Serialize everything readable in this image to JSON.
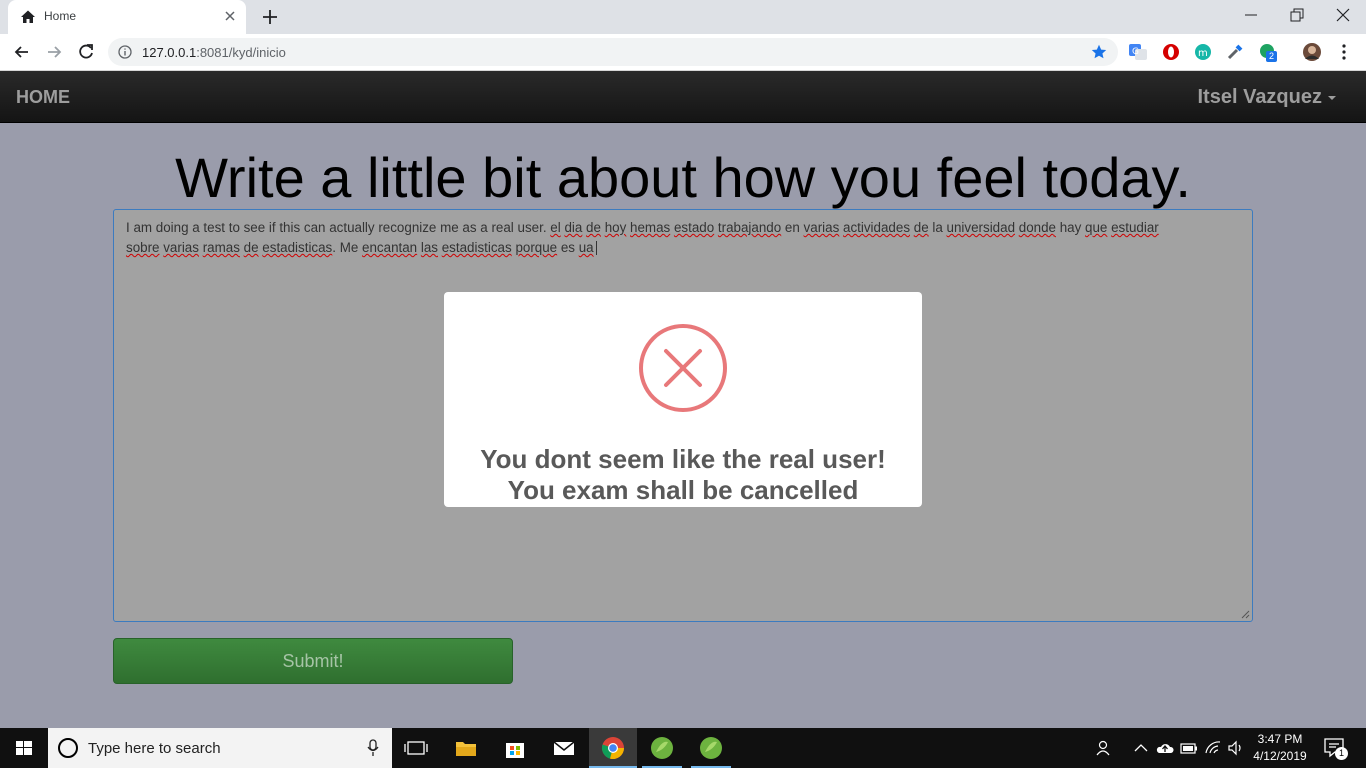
{
  "browser": {
    "tab_title": "Home",
    "url_host": "127.0.0.1",
    "url_path": ":8081/kyd/inicio",
    "icons": [
      "home-icon",
      "close-icon",
      "plus-icon",
      "back-icon",
      "forward-icon",
      "reload-icon",
      "info-icon",
      "star-icon",
      "translate-icon",
      "opera-icon",
      "m-extension-icon",
      "eyedropper-icon",
      "green-extension-icon",
      "profile-avatar"
    ],
    "extension_badge": "2"
  },
  "navbar": {
    "brand": "HOME",
    "user": "Itsel Vazquez"
  },
  "page": {
    "heading": "Write a little bit about how you feel today.",
    "text_line1_parts": [
      {
        "t": "I am doing a test to see if this can actually recognize me as a real user. ",
        "spell": false
      },
      {
        "t": "el",
        "spell": true
      },
      {
        "t": " ",
        "spell": false
      },
      {
        "t": "dia",
        "spell": true
      },
      {
        "t": " ",
        "spell": false
      },
      {
        "t": "de",
        "spell": true
      },
      {
        "t": " ",
        "spell": false
      },
      {
        "t": "hoy",
        "spell": true
      },
      {
        "t": " ",
        "spell": false
      },
      {
        "t": "hemas",
        "spell": true
      },
      {
        "t": " ",
        "spell": false
      },
      {
        "t": "estado",
        "spell": true
      },
      {
        "t": " ",
        "spell": false
      },
      {
        "t": "trabajando",
        "spell": true
      },
      {
        "t": " en ",
        "spell": false
      },
      {
        "t": "varias",
        "spell": true
      },
      {
        "t": " ",
        "spell": false
      },
      {
        "t": "actividades",
        "spell": true
      },
      {
        "t": " ",
        "spell": false
      },
      {
        "t": "de",
        "spell": true
      },
      {
        "t": " la ",
        "spell": false
      },
      {
        "t": "universidad",
        "spell": true
      },
      {
        "t": " ",
        "spell": false
      },
      {
        "t": "donde",
        "spell": true
      },
      {
        "t": " hay ",
        "spell": false
      },
      {
        "t": "que",
        "spell": true
      },
      {
        "t": " ",
        "spell": false
      },
      {
        "t": "estudiar",
        "spell": true
      }
    ],
    "text_line2_parts": [
      {
        "t": "sobre",
        "spell": true
      },
      {
        "t": " ",
        "spell": false
      },
      {
        "t": "varias",
        "spell": true
      },
      {
        "t": " ",
        "spell": false
      },
      {
        "t": "ramas",
        "spell": true
      },
      {
        "t": " ",
        "spell": false
      },
      {
        "t": "de",
        "spell": true
      },
      {
        "t": " ",
        "spell": false
      },
      {
        "t": "estadisticas",
        "spell": true
      },
      {
        "t": ". Me ",
        "spell": false
      },
      {
        "t": "encantan",
        "spell": true
      },
      {
        "t": " ",
        "spell": false
      },
      {
        "t": "las",
        "spell": true
      },
      {
        "t": " ",
        "spell": false
      },
      {
        "t": "estadisticas",
        "spell": true
      },
      {
        "t": " ",
        "spell": false
      },
      {
        "t": "porque",
        "spell": true
      },
      {
        "t": " es ",
        "spell": false
      },
      {
        "t": "ua",
        "spell": true
      }
    ],
    "submit_label": "Submit!"
  },
  "modal": {
    "icon": "error-x-icon",
    "line1": "You dont seem like the real user!",
    "line2": "You exam shall be cancelled",
    "icon_color": "#e8787a"
  },
  "taskbar": {
    "search_placeholder": "Type here to search",
    "time": "3:47 PM",
    "date": "4/12/2019",
    "notification_count": "1",
    "icons": [
      "windows-start-icon",
      "cortana-icon",
      "microphone-icon",
      "task-view-icon",
      "file-explorer-icon",
      "store-icon",
      "mail-icon",
      "chrome-icon",
      "spring-tool-icon",
      "spring-tool-icon-2",
      "people-icon",
      "chevron-up-icon",
      "onedrive-icon",
      "battery-icon",
      "wifi-icon",
      "volume-icon",
      "action-center-icon"
    ]
  }
}
